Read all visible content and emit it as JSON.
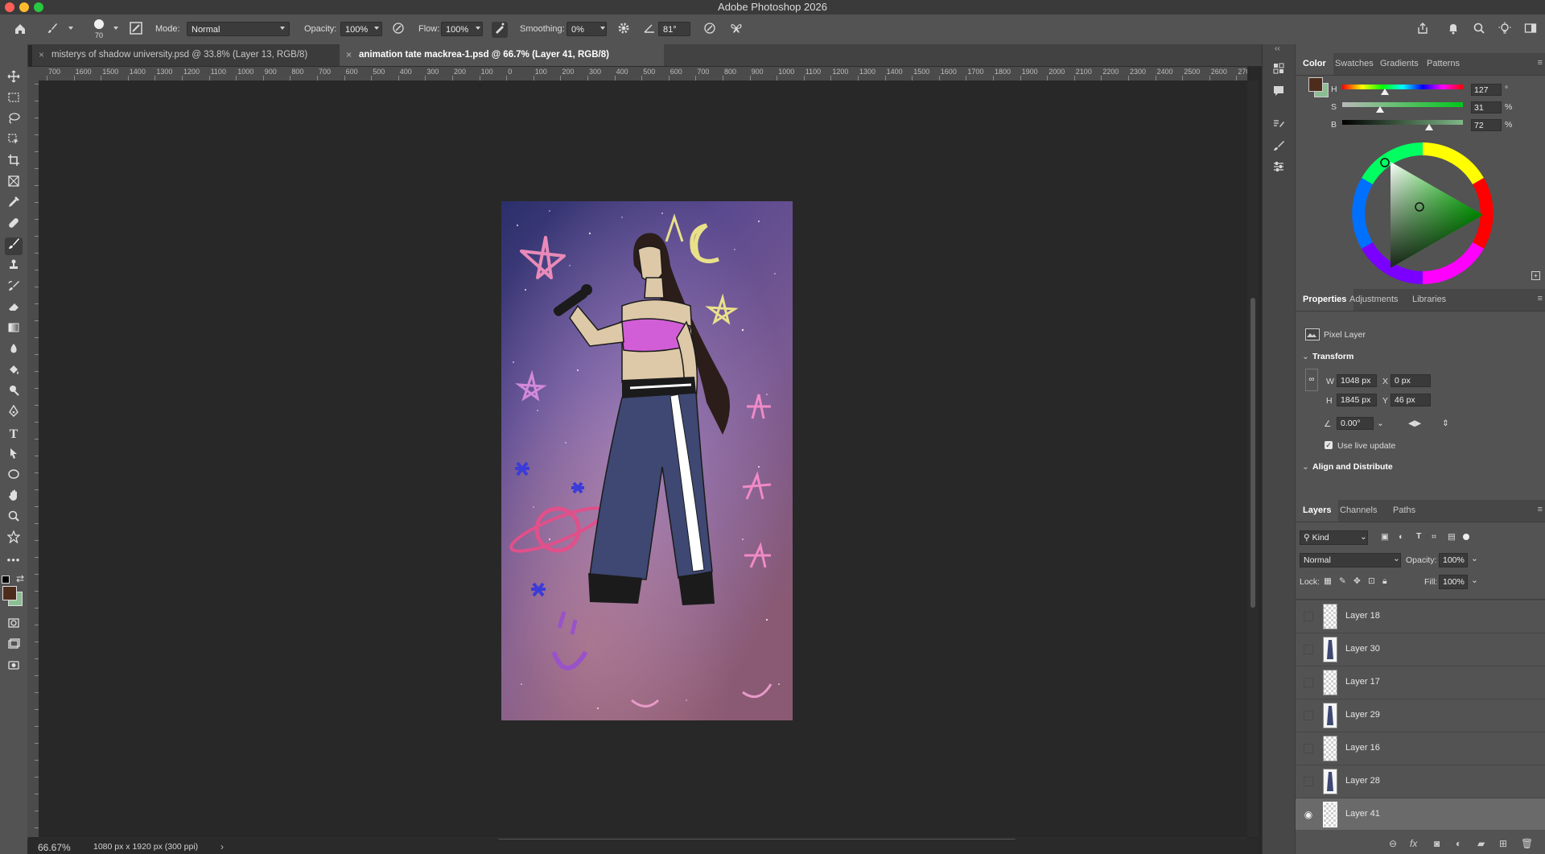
{
  "app": {
    "title": "Adobe Photoshop 2026"
  },
  "options_bar": {
    "brush_size": "70",
    "mode_label": "Mode:",
    "mode_value": "Normal",
    "opacity_label": "Opacity:",
    "opacity_value": "100%",
    "flow_label": "Flow:",
    "flow_value": "100%",
    "smoothing_label": "Smoothing:",
    "smoothing_value": "0%",
    "angle_value": "81°"
  },
  "document_tabs": [
    {
      "label": "misterys of shadow university.psd @ 33.8% (Layer 13, RGB/8)",
      "active": false
    },
    {
      "label": "animation tate mackrea-1.psd @ 66.7% (Layer 41, RGB/8)",
      "active": true
    }
  ],
  "ruler": {
    "h_labels": [
      "700",
      "1600",
      "1500",
      "1400",
      "1300",
      "1200",
      "1100",
      "1000",
      "900",
      "800",
      "700",
      "600",
      "500",
      "400",
      "300",
      "200",
      "100",
      "0",
      "100",
      "200",
      "300",
      "400",
      "500",
      "600",
      "700",
      "800",
      "900",
      "1000",
      "1100",
      "1200",
      "1300",
      "1400",
      "1500",
      "1600",
      "1700",
      "1800",
      "1900",
      "2000",
      "2100",
      "2200",
      "2300",
      "2400",
      "2500",
      "2600",
      "270"
    ]
  },
  "status": {
    "zoom": "66.67%",
    "doc_info": "1080 px x 1920 px (300 ppi)"
  },
  "color_panel": {
    "tabs": [
      "Color",
      "Swatches",
      "Gradients",
      "Patterns"
    ],
    "h_label": "H",
    "h_value": "127",
    "h_unit": "°",
    "h_level": 0.353,
    "s_label": "S",
    "s_value": "31",
    "s_unit": "%",
    "s_level": 0.31,
    "b_label": "B",
    "b_value": "72",
    "b_unit": "%",
    "b_level": 0.72,
    "foreground_color": "#4e2c1c",
    "background_color": "#8bbf92"
  },
  "properties_panel": {
    "tabs": [
      "Properties",
      "Adjustments",
      "Libraries"
    ],
    "layer_type": "Pixel Layer",
    "transform_label": "Transform",
    "w_label": "W",
    "w_value": "1048 px",
    "x_label": "X",
    "x_value": "0 px",
    "h_label": "H",
    "h_value": "1845 px",
    "y_label": "Y",
    "y_value": "46 px",
    "angle_value": "0.00°",
    "live_update_label": "Use live update",
    "align_label": "Align and Distribute"
  },
  "layers_panel": {
    "tabs": [
      "Layers",
      "Channels",
      "Paths"
    ],
    "filter_value": "Kind",
    "blend_mode": "Normal",
    "opacity_label": "Opacity:",
    "opacity_value": "100%",
    "lock_label": "Lock:",
    "fill_label": "Fill:",
    "fill_value": "100%",
    "layers": [
      {
        "name": "Layer 18",
        "visible": false,
        "selected": false
      },
      {
        "name": "Layer 30",
        "visible": false,
        "selected": false
      },
      {
        "name": "Layer 17",
        "visible": false,
        "selected": false
      },
      {
        "name": "Layer 29",
        "visible": false,
        "selected": false
      },
      {
        "name": "Layer 16",
        "visible": false,
        "selected": false
      },
      {
        "name": "Layer 28",
        "visible": false,
        "selected": false
      },
      {
        "name": "Layer 41",
        "visible": true,
        "selected": true
      }
    ]
  }
}
